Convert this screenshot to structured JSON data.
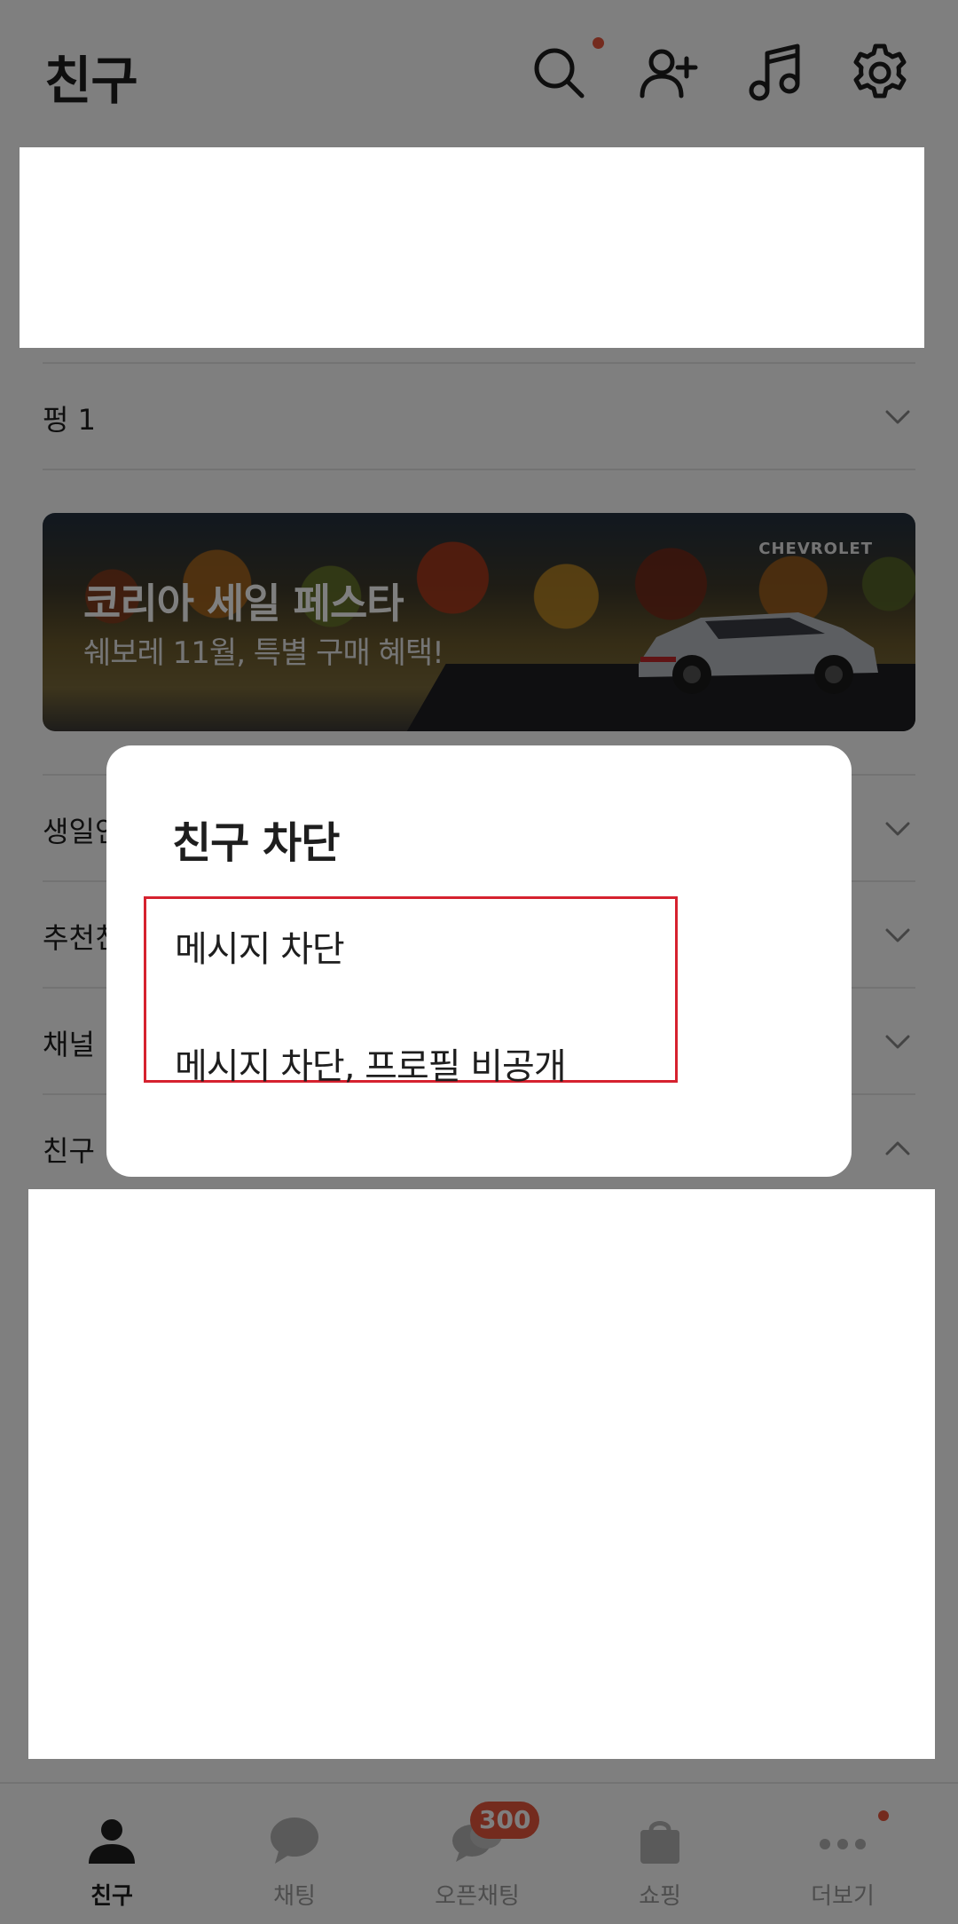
{
  "header": {
    "title": "친구"
  },
  "sections": {
    "p1": "펑 1",
    "birthday": "생일인 친구",
    "recommend": "추천친구",
    "channel": "채널",
    "friends": "친구"
  },
  "banner": {
    "brand": "CHEVROLET",
    "title": "코리아 세일 페스타",
    "subtitle": "쉐보레 11월, 특별 구매 혜택!"
  },
  "dialog": {
    "title": "친구 차단",
    "options": [
      "메시지 차단",
      "메시지 차단, 프로필 비공개"
    ]
  },
  "bottom_nav": {
    "items": [
      {
        "label": "친구",
        "icon": "person-icon"
      },
      {
        "label": "채팅",
        "icon": "chat-bubble-icon"
      },
      {
        "label": "오픈채팅",
        "icon": "open-chat-icon",
        "badge": "300"
      },
      {
        "label": "쇼핑",
        "icon": "shopping-bag-icon"
      },
      {
        "label": "더보기",
        "icon": "more-dots-icon"
      }
    ]
  },
  "colors": {
    "badge": "#e8563c",
    "highlight_border": "#d6222f",
    "overlay": "rgba(0,0,0,0.5)"
  }
}
